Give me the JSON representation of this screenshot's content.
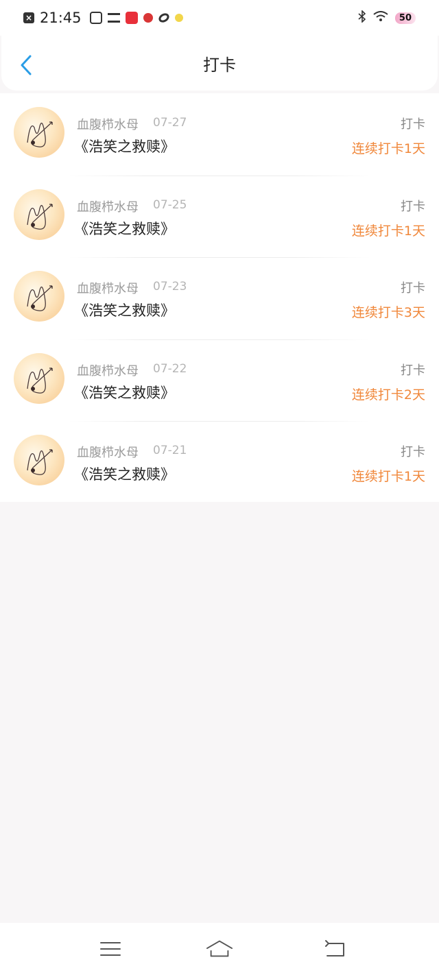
{
  "status_bar": {
    "time": "21:45",
    "battery": "50",
    "icons": [
      "notification-x-icon",
      "qr-icon",
      "stack-icon",
      "app-red-icon",
      "red-ball-icon",
      "ring-icon",
      "yellow-icon",
      "bluetooth-icon",
      "wifi-icon",
      "battery-icon"
    ]
  },
  "header": {
    "title": "打卡",
    "back_icon": "chevron-left-icon",
    "accent_color": "#2a9de6"
  },
  "checkins": [
    {
      "user": "血腹栉水母",
      "date": "07-27",
      "title": "《浩笑之救赎》",
      "action": "打卡",
      "streak": "连续打卡1天"
    },
    {
      "user": "血腹栉水母",
      "date": "07-25",
      "title": "《浩笑之救赎》",
      "action": "打卡",
      "streak": "连续打卡1天"
    },
    {
      "user": "血腹栉水母",
      "date": "07-23",
      "title": "《浩笑之救赎》",
      "action": "打卡",
      "streak": "连续打卡3天"
    },
    {
      "user": "血腹栉水母",
      "date": "07-22",
      "title": "《浩笑之救赎》",
      "action": "打卡",
      "streak": "连续打卡2天"
    },
    {
      "user": "血腹栉水母",
      "date": "07-21",
      "title": "《浩笑之救赎》",
      "action": "打卡",
      "streak": "连续打卡1天"
    }
  ],
  "colors": {
    "streak": "#f0873a",
    "background": "#f8f6f7"
  },
  "bottom_nav": [
    "menu-icon",
    "home-icon",
    "back-icon"
  ]
}
